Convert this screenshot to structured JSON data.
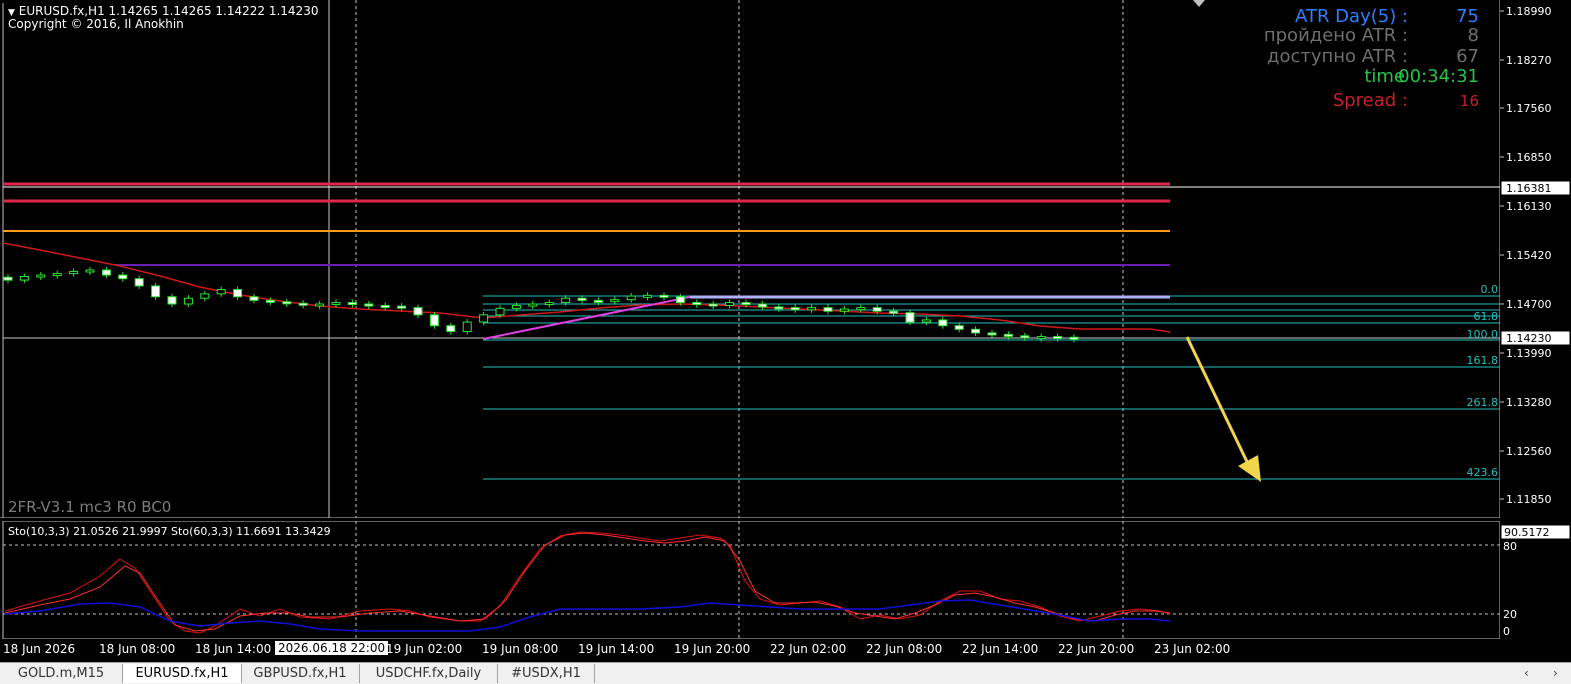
{
  "header": {
    "symbol_line": "EURUSD.fx,H1  1.14265 1.14265 1.14222 1.14230",
    "copyright": "Copyright © 2016, Il Anokhin"
  },
  "atr_panel": {
    "rows": [
      {
        "label": "ATR Day(5) :",
        "value": "75",
        "color": "#2e7fff"
      },
      {
        "label": "пройдено ATR :",
        "value": "8",
        "color": "#6f6f6f"
      },
      {
        "label": "доступно ATR :",
        "value": "67",
        "color": "#6f6f6f"
      },
      {
        "label": "time",
        "value": "00:34:31",
        "color": "#26c24a"
      },
      {
        "label": "Spread :",
        "value": "16",
        "color": "#c8202a"
      }
    ]
  },
  "watermark": "2FR-V3.1 mc3 R0 BC0",
  "oscillator": {
    "label": "Sto(10,3,3) 21.0526 21.9997  Sto(60,3,3) 11.6691 13.3429",
    "scale": {
      "top": "90.5172",
      "upper": "80",
      "lower": "20",
      "zero": "0"
    }
  },
  "price_axis": {
    "ticks": [
      "1.18990",
      "1.18270",
      "1.17560",
      "1.16850",
      "1.16130",
      "1.15420",
      "1.14700",
      "1.13990",
      "1.13280",
      "1.12560",
      "1.11850"
    ],
    "boxed_labels": [
      "1.16381",
      "1.14230"
    ]
  },
  "fib_labels": [
    "0.0",
    "61.8",
    "100.0",
    "161.8",
    "261.8",
    "423.6"
  ],
  "time_axis": {
    "labels": [
      "18 Jun 2026",
      "18 Jun 08:00",
      "18 Jun 14:00",
      "2026.06.18 22:00",
      "19 Jun 02:00",
      "19 Jun 08:00",
      "19 Jun 14:00",
      "19 Jun 20:00",
      "22 Jun 02:00",
      "22 Jun 08:00",
      "22 Jun 14:00",
      "22 Jun 20:00",
      "23 Jun 02:00"
    ]
  },
  "tabs": [
    {
      "label": "GOLD.m,M15",
      "active": false
    },
    {
      "label": "EURUSD.fx,H1",
      "active": true
    },
    {
      "label": "GBPUSD.fx,H1",
      "active": false
    },
    {
      "label": "USDCHF.fx,Daily",
      "active": false
    },
    {
      "label": "#USDX,H1",
      "active": false
    }
  ],
  "chart_data": {
    "type": "candlestick",
    "symbol": "EURUSD.fx",
    "timeframe": "H1",
    "last_ohlc": {
      "open": 1.14265,
      "high": 1.14265,
      "low": 1.14222,
      "close": 1.1423
    },
    "ylim": [
      1.115,
      1.192
    ],
    "horizontal_levels": [
      {
        "price": 1.1638,
        "color": "#e0274b"
      },
      {
        "price": 1.1613,
        "color": "#e0274b"
      },
      {
        "price": 1.1571,
        "color": "#ff9a1a"
      },
      {
        "price": 1.152,
        "color": "#6a1fb0"
      }
    ],
    "fibonacci": {
      "levels": [
        {
          "label": "0.0",
          "price": 1.1478
        },
        {
          "label": "61.8",
          "price": 1.1455
        },
        {
          "label": "100.0",
          "price": 1.142
        },
        {
          "label": "161.8",
          "price": 1.138
        },
        {
          "label": "261.8",
          "price": 1.1317
        },
        {
          "label": "423.6",
          "price": 1.1215
        }
      ]
    },
    "close_series": [
      1.1503,
      1.1508,
      1.151,
      1.1512,
      1.1515,
      1.1517,
      1.151,
      1.1505,
      1.1495,
      1.148,
      1.147,
      1.1478,
      1.1484,
      1.149,
      1.148,
      1.1475,
      1.1473,
      1.1471,
      1.147,
      1.147,
      1.1472,
      1.147,
      1.1468,
      1.1467,
      1.1465,
      1.1455,
      1.144,
      1.1432,
      1.1445,
      1.1455,
      1.1464,
      1.1468,
      1.147,
      1.1472,
      1.1478,
      1.1475,
      1.1474,
      1.1476,
      1.1481,
      1.1482,
      1.148,
      1.1472,
      1.147,
      1.1468,
      1.1472,
      1.147,
      1.1466,
      1.1465,
      1.1462,
      1.1465,
      1.146,
      1.1463,
      1.1465,
      1.146,
      1.1458,
      1.1445,
      1.1448,
      1.144,
      1.1435,
      1.143,
      1.1428,
      1.1426,
      1.1425,
      1.1425,
      1.1424,
      1.1423
    ]
  }
}
